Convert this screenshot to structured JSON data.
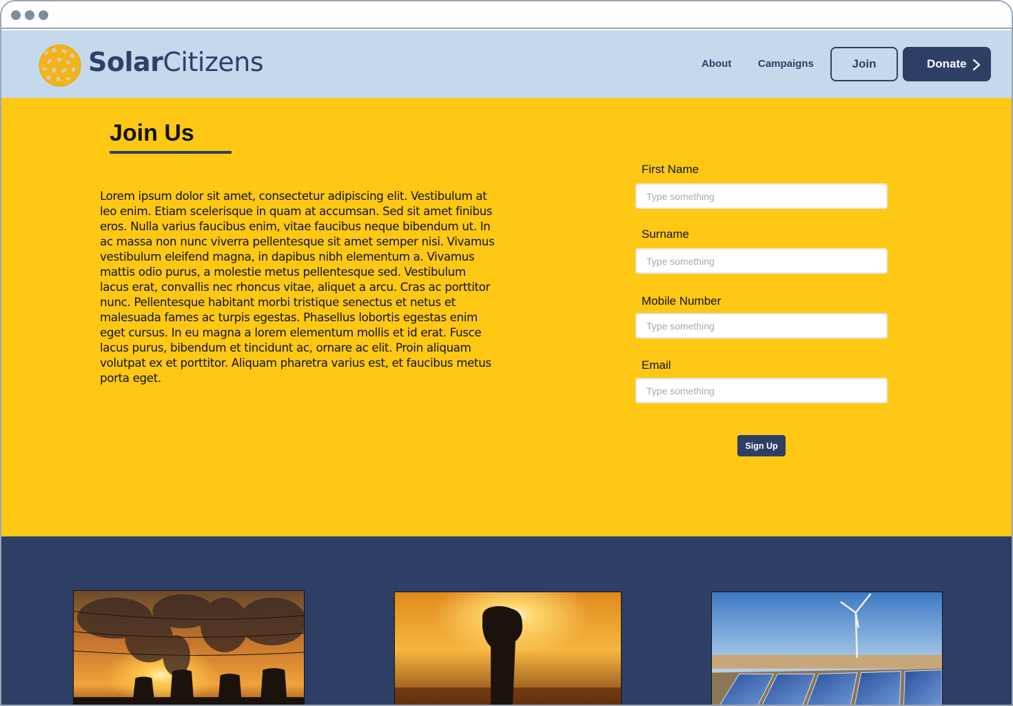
{
  "brand": {
    "name_bold": "Solar",
    "name_light": "Citizens",
    "logo_color": "#f4b31a",
    "text_color": "#2e4069"
  },
  "nav": {
    "links": [
      "About",
      "Campaigns"
    ],
    "join_label": "Join",
    "donate_label": "Donate"
  },
  "join": {
    "title": "Join Us",
    "body": "Lorem ipsum dolor sit amet, consectetur adipiscing elit. Vestibulum at leo enim. Etiam scelerisque in quam at accumsan. Sed sit amet finibus eros. Nulla varius faucibus enim, vitae faucibus neque bibendum ut. In ac massa non nunc viverra pellentesque sit amet semper nisi. Vivamus vestibulum eleifend magna, in dapibus nibh elementum a. Vivamus mattis odio purus, a molestie metus pellentesque sed. Vestibulum lacus erat, convallis nec rhoncus vitae, aliquet a arcu. Cras ac porttitor nunc. Pellentesque habitant morbi tristique senectus et netus et malesuada fames ac turpis egestas. Phasellus lobortis egestas enim eget cursus. In eu magna a lorem elementum mollis et id erat. Fusce lacus purus, bibendum et tincidunt ac, ornare ac elit. Proin aliquam volutpat ex et porttitor. Aliquam pharetra varius est, et faucibus metus porta eget."
  },
  "form": {
    "fields": [
      {
        "label": "First Name",
        "placeholder": "Type something",
        "value": ""
      },
      {
        "label": "Surname",
        "placeholder": "Type something",
        "value": ""
      },
      {
        "label": "Mobile Number",
        "placeholder": "Type something",
        "value": ""
      },
      {
        "label": "Email",
        "placeholder": "Type something",
        "value": ""
      }
    ],
    "submit_label": "Sign Up"
  },
  "colors": {
    "nav_bg": "#c4d9ec",
    "main_bg": "#fec815",
    "footer_bg": "#2e3f66",
    "accent": "#2e3f66"
  },
  "footer": {
    "images": [
      "power-plant-smoke-image",
      "raised-fist-sunset-image",
      "solar-panels-wind-turbine-image"
    ]
  }
}
